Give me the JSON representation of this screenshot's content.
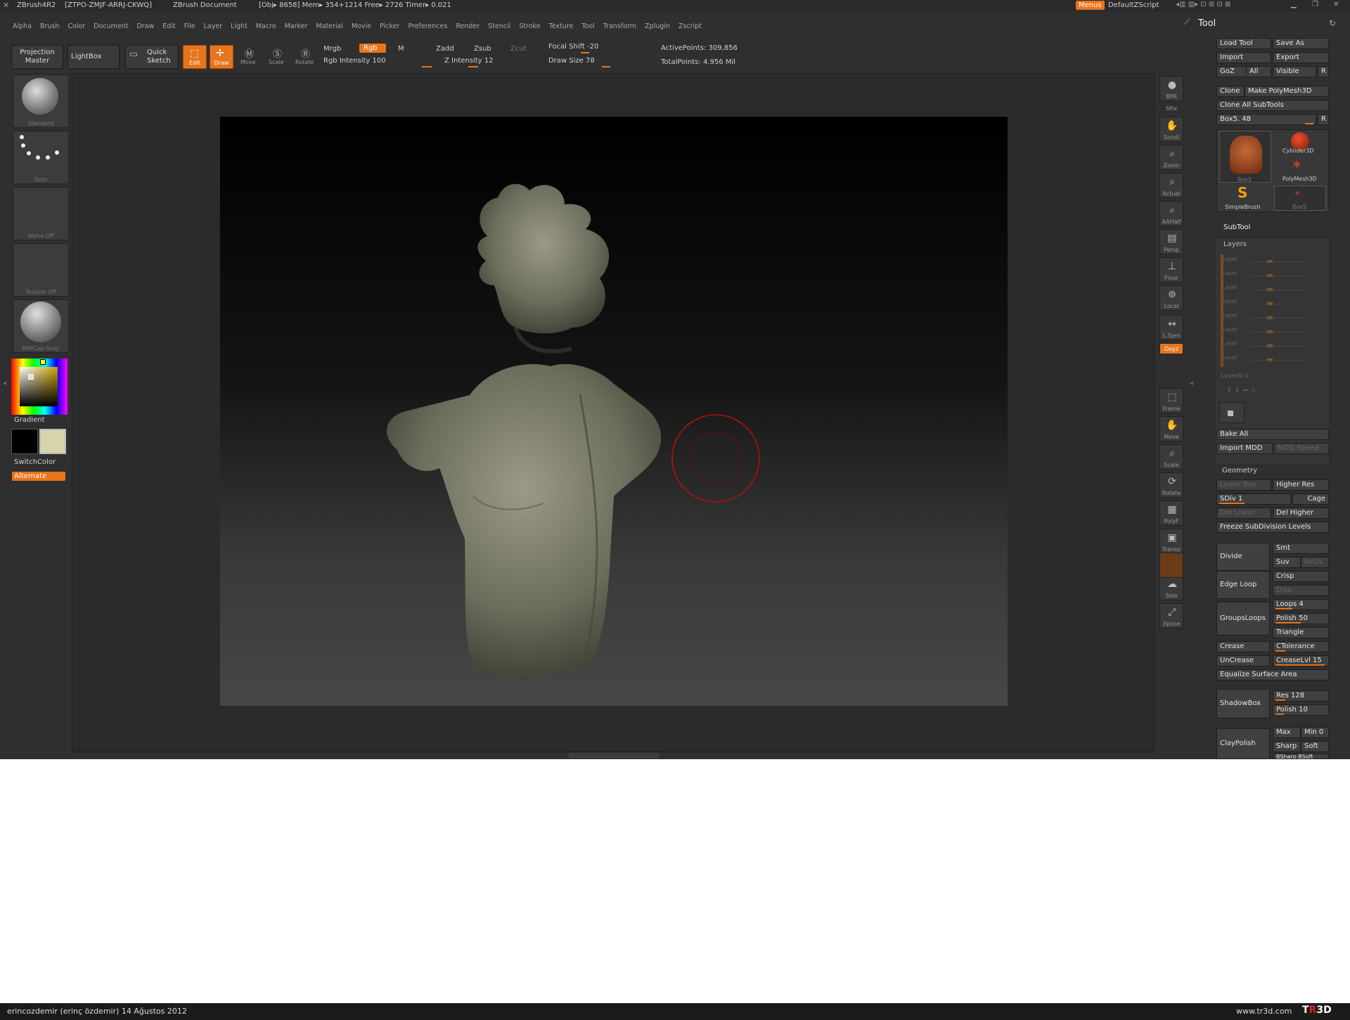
{
  "titlebar": {
    "app": "ZBrush4R2",
    "serial": "[ZTPO-ZMJF-ARRJ-CKWQ]",
    "doc": "ZBrush Document",
    "stats": "[Obj▸ 8658]  Mem▸ 354+1214  Free▸ 2726  Timer▸ 0.021",
    "menus_btn": "Menus",
    "script": "DefaultZScript"
  },
  "menubar": [
    "Alpha",
    "Brush",
    "Color",
    "Document",
    "Draw",
    "Edit",
    "File",
    "Layer",
    "Light",
    "Macro",
    "Marker",
    "Material",
    "Movie",
    "Picker",
    "Preferences",
    "Render",
    "Stencil",
    "Stroke",
    "Texture",
    "Tool",
    "Transform",
    "Zplugin",
    "Zscript"
  ],
  "shelf": {
    "projection_master": "Projection Master",
    "lightbox": "LightBox",
    "quick_sketch": "Quick Sketch",
    "edit": "Edit",
    "draw": "Draw",
    "move": "Move",
    "scale": "Scale",
    "rotate": "Rotate",
    "mrgb": "Mrgb",
    "rgb": "Rgb",
    "m": "M",
    "zadd": "Zadd",
    "zsub": "Zsub",
    "zcut": "Zcut",
    "rgb_intensity": "Rgb  Intensity 100",
    "z_intensity": "Z  Intensity 12",
    "focal_shift": "Focal  Shift -20",
    "draw_size": "Draw  Size 78",
    "active_points": "ActivePoints: 309,856",
    "total_points": "TotalPoints: 4.956  Mil"
  },
  "left": {
    "brush": "Standard",
    "stroke": "Dots",
    "alpha": "Alpha  Off",
    "texture": "Texture  Off",
    "material": "MatCap  Gray",
    "gradient": "Gradient",
    "switchcolor": "SwitchColor",
    "alternate": "Alternate"
  },
  "nav": [
    {
      "name": "bpr",
      "label": "BPR"
    },
    {
      "name": "spix",
      "label": "SPix"
    },
    {
      "name": "scroll",
      "label": "Scroll"
    },
    {
      "name": "zoom",
      "label": "Zoom"
    },
    {
      "name": "actual",
      "label": "Actual"
    },
    {
      "name": "aahalf",
      "label": "AAHalf"
    },
    {
      "name": "persp",
      "label": "Persp"
    },
    {
      "name": "floor",
      "label": "Floor"
    },
    {
      "name": "local",
      "label": "Local"
    },
    {
      "name": "lsym",
      "label": "L.Sym"
    },
    {
      "name": "xyz",
      "label": "Oxyz"
    },
    {
      "name": "frame",
      "label": "Frame"
    },
    {
      "name": "move",
      "label": "Move"
    },
    {
      "name": "scale",
      "label": "Scale"
    },
    {
      "name": "rotate",
      "label": "Rotate"
    },
    {
      "name": "polyf",
      "label": "PolyF"
    },
    {
      "name": "transp",
      "label": "Transp"
    },
    {
      "name": "solo",
      "label": "Solo"
    },
    {
      "name": "xpose",
      "label": "Xpose"
    }
  ],
  "tool": {
    "title": "Tool",
    "load_tool": "Load  Tool",
    "save_as": "Save  As",
    "import": "Import",
    "export": "Export",
    "goz": "GoZ",
    "all": "All",
    "visible": "Visible",
    "r": "R",
    "clone": "Clone",
    "make_polymesh": "Make  PolyMesh3D",
    "clone_all": "Clone  All  SubTools",
    "current": "Box5.  48",
    "thumbs": [
      "Box5",
      "Cylinder3D",
      "PolyMesh3D",
      "SimpleBrush",
      "Box5"
    ],
    "subtool": "SubTool",
    "layers": "Layers",
    "layer_label": "Layer",
    "layer0": "Layer0-1",
    "bake_all": "Bake  All",
    "import_mdd": "Import  MDD",
    "mdd_speed": "MDD  Speed"
  },
  "geometry": {
    "title": "Geometry",
    "lower_res": "Lower  Res",
    "higher_res": "Higher  Res",
    "sdiv": "SDiv 1",
    "cage": "Cage",
    "del_lower": "Del  Lower",
    "del_higher": "Del  Higher",
    "freeze": "Freeze  SubDivision  Levels",
    "divide": "Divide",
    "smt": "Smt",
    "suv": "Suv",
    "reuv": "ReUV",
    "edge_loop": "Edge  Loop",
    "crisp": "Crisp",
    "disp": "Disp",
    "groupsloops": "GroupsLoops",
    "loops": "Loops 4",
    "polish": "Polish 50",
    "triangle": "Triangle",
    "crease": "Crease",
    "ctolerance": "CTolerance",
    "uncrease": "UnCrease",
    "creaselvl": "CreaseLvl 15",
    "equalize": "Equalize  Surface  Area",
    "shadowbox": "ShadowBox",
    "res": "Res 128",
    "polish10": "Polish 10",
    "claypolish": "ClayPolish",
    "max": "Max",
    "min": "Min 0",
    "sharp": "Sharp",
    "soft": "Soft",
    "bsharp": "BSharp  BSoft"
  },
  "footer": {
    "left": "erincozdemir (erinç özdemir)  14 Ağustos 2012",
    "right": "www.tr3d.com",
    "logo": "TR3D"
  }
}
